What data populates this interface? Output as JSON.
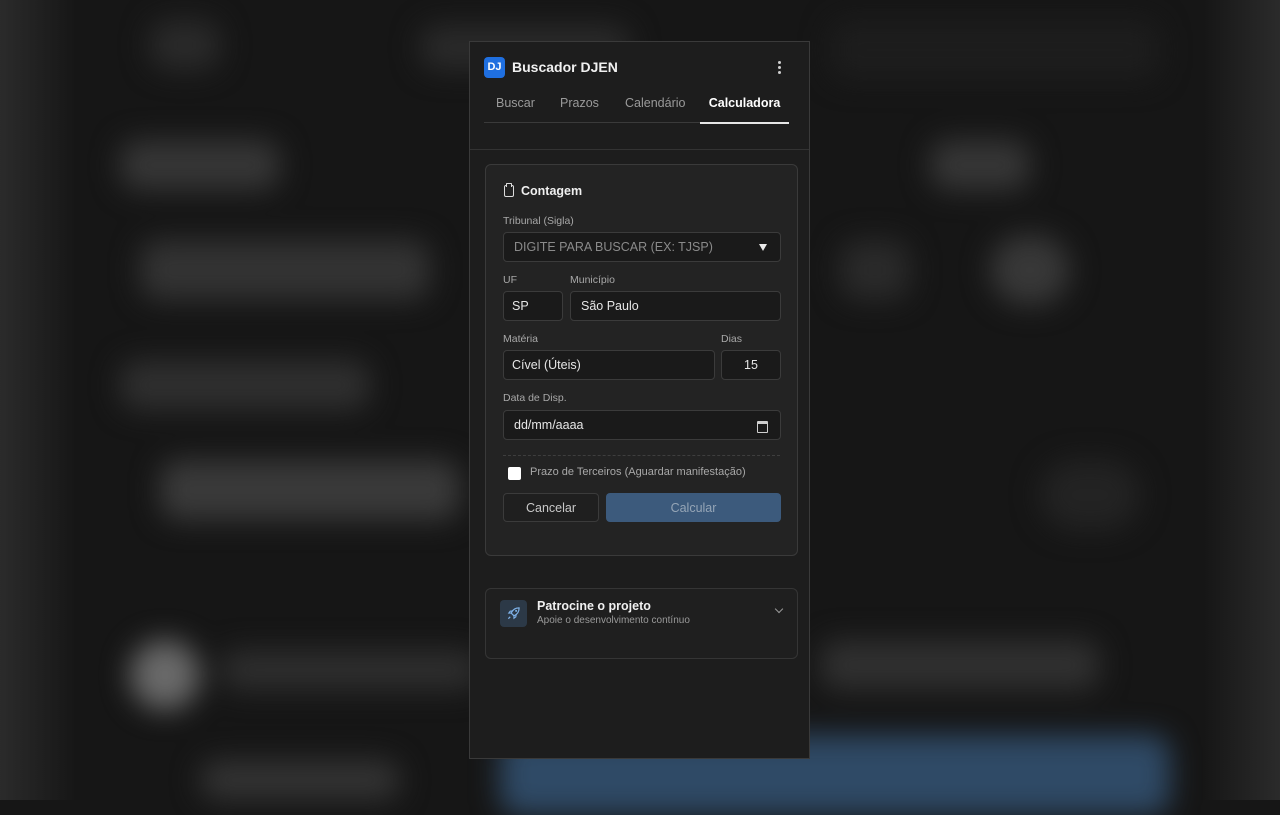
{
  "app": {
    "logo_text": "DJ",
    "title": "Buscador DJEN"
  },
  "tabs": [
    {
      "label": "Buscar"
    },
    {
      "label": "Prazos"
    },
    {
      "label": "Calendário"
    },
    {
      "label": "Calculadora",
      "active": true
    }
  ],
  "form": {
    "section_title": "Contagem",
    "tribunal": {
      "label": "Tribunal (Sigla)",
      "placeholder": "DIGITE PARA BUSCAR (EX: TJSP)"
    },
    "uf": {
      "label": "UF",
      "value": "SP"
    },
    "municipio": {
      "label": "Município",
      "value": "São Paulo"
    },
    "materia": {
      "label": "Matéria",
      "value": "Cível (Úteis)"
    },
    "dias": {
      "label": "Dias",
      "value": "15"
    },
    "data_disp": {
      "label": "Data de Disp.",
      "placeholder": "dd/mm/aaaa"
    },
    "prazo_terceiros": {
      "label": "Prazo de Terceiros (Aguardar manifestação)",
      "checked": false
    },
    "cancel_label": "Cancelar",
    "calc_label": "Calcular"
  },
  "sponsor": {
    "title": "Patrocine o projeto",
    "subtitle": "Apoie o desenvolvimento contínuo"
  },
  "colors": {
    "accent": "#1f6fe0",
    "calc_button": "#3c5a7c",
    "panel_bg": "#1d1d1d"
  }
}
